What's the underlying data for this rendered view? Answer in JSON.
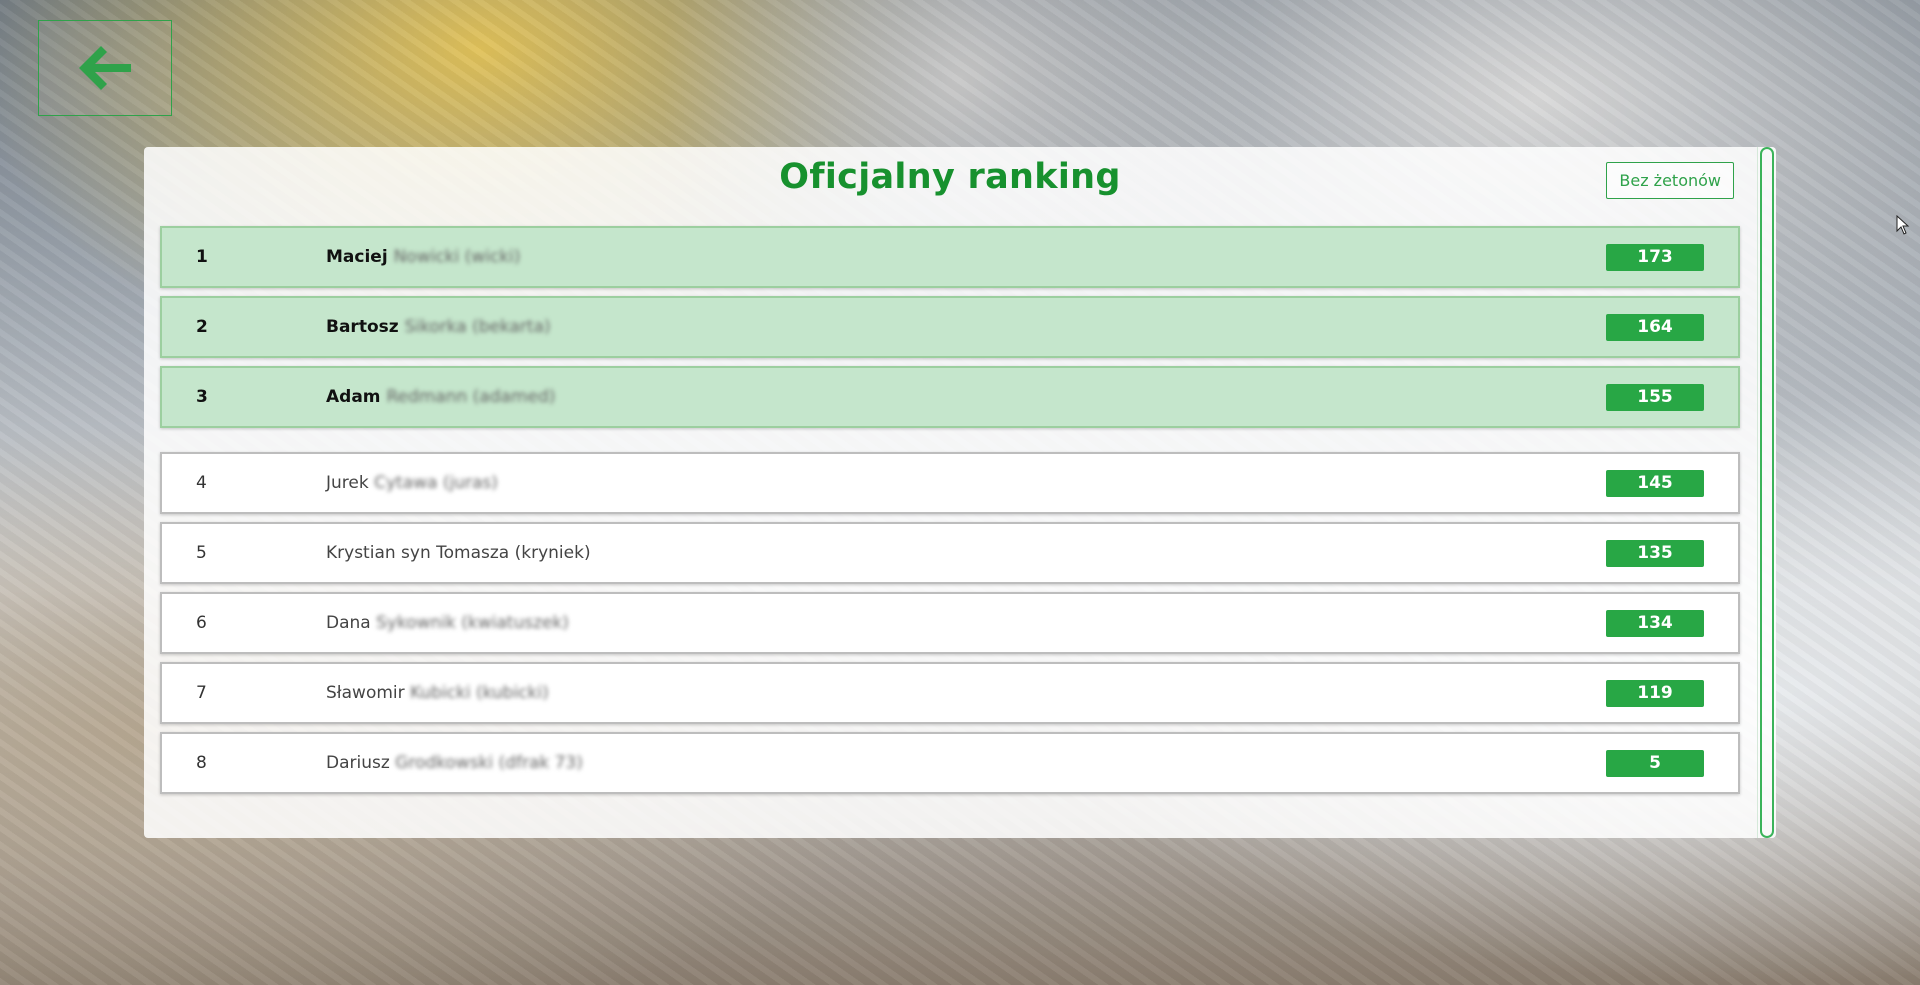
{
  "title": "Oficjalny ranking",
  "filter_button_label": "Bez żetonów",
  "icons": {
    "back": "arrow-left-icon"
  },
  "colors": {
    "accent": "#28a745",
    "title": "#17912e",
    "top_row": "#c5e6cc"
  },
  "ranking": [
    {
      "position": "1",
      "first_name": "Maciej",
      "rest": "Nowicki (wicki)",
      "score": "173",
      "top": true
    },
    {
      "position": "2",
      "first_name": "Bartosz",
      "rest": "Sikorka (bekarta)",
      "score": "164",
      "top": true
    },
    {
      "position": "3",
      "first_name": "Adam",
      "rest": "Redmann (adamed)",
      "score": "155",
      "top": true
    },
    {
      "position": "4",
      "first_name": "Jurek",
      "rest": "Cytawa (juras)",
      "score": "145",
      "top": false
    },
    {
      "position": "5",
      "first_name": "Krystian syn Tomasza (kryniek)",
      "rest": "",
      "score": "135",
      "top": false
    },
    {
      "position": "6",
      "first_name": "Dana",
      "rest": "Sykownik (kwiatuszek)",
      "score": "134",
      "top": false
    },
    {
      "position": "7",
      "first_name": "Sławomir",
      "rest": "Kubicki (kubicki)",
      "score": "119",
      "top": false
    },
    {
      "position": "8",
      "first_name": "Dariusz",
      "rest": "Grodkowski (dfrak 73)",
      "score": "5",
      "top": false
    }
  ]
}
